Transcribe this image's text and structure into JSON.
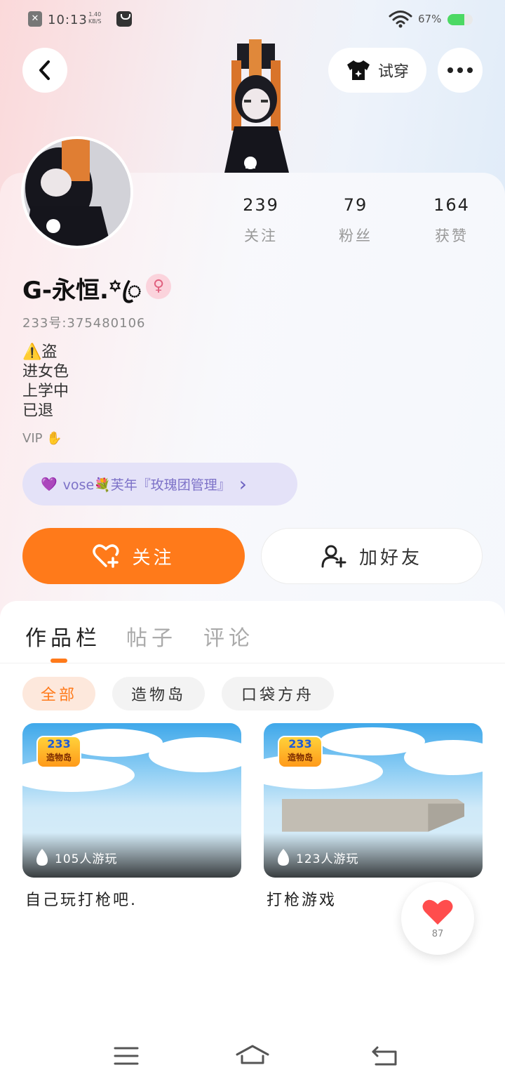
{
  "status_bar": {
    "time": "10:13",
    "speed_value": "1.40",
    "speed_unit": "KB/S",
    "battery_text": "67%",
    "battery_level": 0.67
  },
  "header": {
    "tryon_label": "试穿"
  },
  "profile": {
    "stats": [
      {
        "value": "239",
        "label": "关注"
      },
      {
        "value": "79",
        "label": "粉丝"
      },
      {
        "value": "164",
        "label": "获赞"
      }
    ],
    "username": "G-永恒.꙳ꦿ",
    "gender_symbol": "♀",
    "user_id": "233号:375480106",
    "bio": "⚠️盗\n进女色\n上学中\n已退",
    "vip": "VIP ✋",
    "family": {
      "icon": "💜",
      "label": "vose💐芙年『玫瑰团管理』",
      "chevron": "›"
    },
    "follow_label": "关注",
    "add_friend_label": "加好友"
  },
  "tabs": [
    {
      "label": "作品栏",
      "active": true
    },
    {
      "label": "帖子",
      "active": false
    },
    {
      "label": "评论",
      "active": false
    }
  ],
  "filters": [
    {
      "label": "全部",
      "active": true
    },
    {
      "label": "造物岛",
      "active": false
    },
    {
      "label": "口袋方舟",
      "active": false
    }
  ],
  "games": [
    {
      "logo_top": "233",
      "logo_bottom": "造物岛",
      "players": "105人游玩",
      "title": "自己玩打枪吧."
    },
    {
      "logo_top": "233",
      "logo_bottom": "造物岛",
      "players": "123人游玩",
      "title": "打枪游戏"
    }
  ],
  "like": {
    "count": "87"
  },
  "colors": {
    "accent": "#ff7a1a",
    "family_pill": "#e4e2f8",
    "gender_badge": "#fbd3dc"
  },
  "icons": [
    "back-icon",
    "tshirt-icon",
    "more-icon",
    "heart-plus-icon",
    "add-user-icon",
    "flame-icon",
    "heart-icon",
    "menu-icon",
    "home-icon",
    "return-icon",
    "wifi-icon",
    "battery-icon"
  ]
}
